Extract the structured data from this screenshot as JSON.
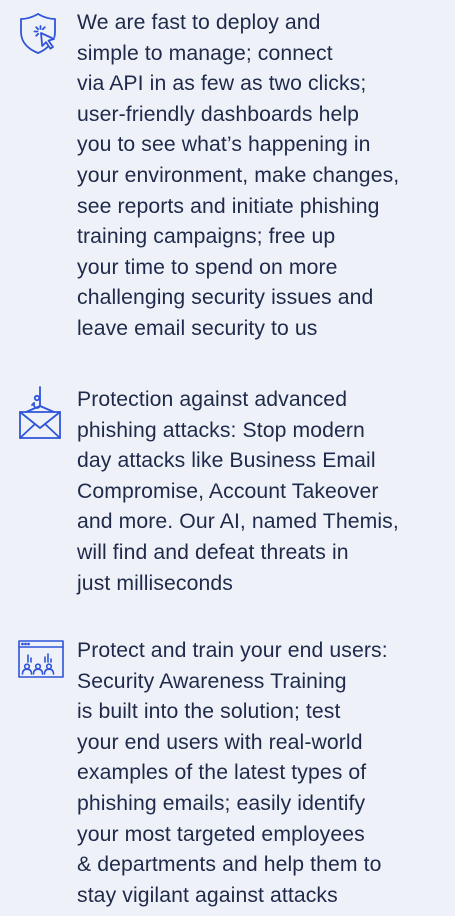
{
  "colors": {
    "icon_stroke": "#2f54d9",
    "text": "#1f2a4a",
    "background": "#eef1f8"
  },
  "features": [
    {
      "icon": "shield-click-icon",
      "lines": [
        "We are fast to deploy and",
        "simple to manage; connect",
        "via API in as few as two clicks;",
        "user-friendly dashboards help",
        "you to see what’s happening in",
        "your environment, make changes,",
        "see reports and initiate phishing",
        "training campaigns; free up",
        "your time to spend on more",
        "challenging security issues and",
        "leave email security to us"
      ]
    },
    {
      "icon": "phishing-hook-envelope-icon",
      "lines": [
        "Protection against advanced",
        "phishing attacks: Stop modern",
        "day attacks like Business Email",
        "Compromise, Account Takeover",
        "and more. Our AI, named Themis,",
        "will find and defeat threats in",
        "just milliseconds"
      ]
    },
    {
      "icon": "dashboard-users-icon",
      "lines": [
        "Protect and train your end users:",
        "Security Awareness Training",
        "is built into the solution; test",
        "your end users with real-world",
        "examples of the latest types of",
        "phishing emails; easily identify",
        "your most targeted employees",
        "& departments and help them to",
        "stay vigilant against attacks"
      ]
    }
  ]
}
